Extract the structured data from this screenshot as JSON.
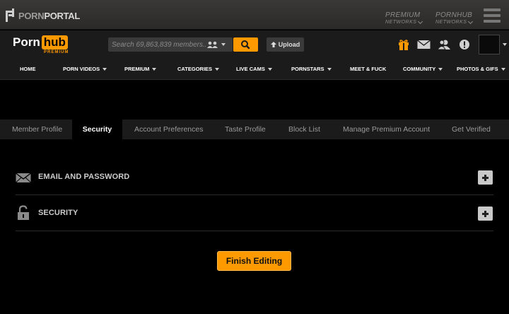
{
  "portal": {
    "logo_prefix": "PORN",
    "logo_suffix": "PORTAL",
    "networks": [
      {
        "title": "PREMIUM",
        "sub": "NETWORKS"
      },
      {
        "title": "PORNHUB",
        "sub": "NETWORKS"
      }
    ]
  },
  "header": {
    "logo_porn": "Porn",
    "logo_hub": "hub",
    "logo_sub": "PREMIUM",
    "search_placeholder": "Search 69,863,839 members...",
    "upload_label": "Upload",
    "icons": [
      "gift-icon",
      "mail-icon",
      "friends-icon",
      "alert-icon"
    ],
    "accent": "#ff9900"
  },
  "nav": [
    {
      "label": "HOME",
      "dropdown": false
    },
    {
      "label": "PORN VIDEOS",
      "dropdown": true
    },
    {
      "label": "PREMIUM",
      "dropdown": true
    },
    {
      "label": "CATEGORIES",
      "dropdown": true
    },
    {
      "label": "LIVE CAMS",
      "dropdown": true
    },
    {
      "label": "PORNSTARS",
      "dropdown": true
    },
    {
      "label": "MEET & FUCK",
      "dropdown": false
    },
    {
      "label": "COMMUNITY",
      "dropdown": true
    },
    {
      "label": "PHOTOS & GIFS",
      "dropdown": true
    }
  ],
  "tabs": [
    {
      "label": "Member Profile",
      "active": false
    },
    {
      "label": "Security",
      "active": true
    },
    {
      "label": "Account Preferences",
      "active": false
    },
    {
      "label": "Taste Profile",
      "active": false
    },
    {
      "label": "Block List",
      "active": false
    },
    {
      "label": "Manage Premium Account",
      "active": false
    },
    {
      "label": "Get Verified",
      "active": false
    }
  ],
  "sections": [
    {
      "title": "EMAIL AND PASSWORD",
      "icon": "envelope-icon"
    },
    {
      "title": "SECURITY",
      "icon": "lock-icon"
    }
  ],
  "finish_label": "Finish Editing"
}
